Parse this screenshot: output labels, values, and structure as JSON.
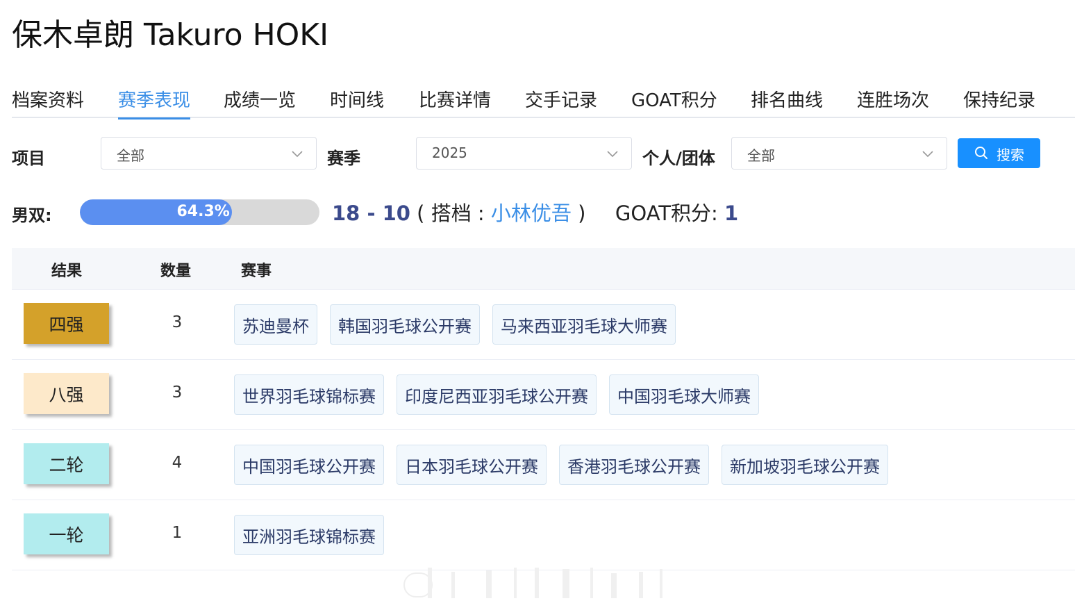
{
  "page": {
    "title": "保木卓朗 Takuro HOKI"
  },
  "tabs": [
    {
      "label": "档案资料"
    },
    {
      "label": "赛季表现",
      "active": true
    },
    {
      "label": "成绩一览"
    },
    {
      "label": "时间线"
    },
    {
      "label": "比赛详情"
    },
    {
      "label": "交手记录"
    },
    {
      "label": "GOAT积分"
    },
    {
      "label": "排名曲线"
    },
    {
      "label": "连胜场次"
    },
    {
      "label": "保持纪录"
    }
  ],
  "filters": {
    "event": {
      "label": "项目",
      "value": "全部"
    },
    "season": {
      "label": "赛季",
      "value": "2025"
    },
    "type": {
      "label": "个人/团体",
      "value": "全部"
    },
    "search_label": "搜索"
  },
  "summary": {
    "label": "男双:",
    "win_rate": 64.3,
    "win_rate_text": "64.3%",
    "record": "18 - 10",
    "partner_prefix": "( 搭档 :",
    "partner": "小林优吾",
    "partner_suffix": ")",
    "goat_label": "GOAT积分:",
    "goat_value": "1"
  },
  "table": {
    "headers": {
      "result": "结果",
      "count": "数量",
      "events": "赛事"
    },
    "rows": [
      {
        "result": "四强",
        "color": "#d4a12a",
        "count": "3",
        "events": [
          "苏迪曼杯",
          "韩国羽毛球公开赛",
          "马来西亚羽毛球大师赛"
        ]
      },
      {
        "result": "八强",
        "color": "#fde9ca",
        "count": "3",
        "events": [
          "世界羽毛球锦标赛",
          "印度尼西亚羽毛球公开赛",
          "中国羽毛球大师赛"
        ]
      },
      {
        "result": "二轮",
        "color": "#b2ecee",
        "count": "4",
        "events": [
          "中国羽毛球公开赛",
          "日本羽毛球公开赛",
          "香港羽毛球公开赛",
          "新加坡羽毛球公开赛"
        ]
      },
      {
        "result": "一轮",
        "color": "#b2ecee",
        "count": "1",
        "events": [
          "亚洲羽毛球锦标赛"
        ]
      }
    ]
  },
  "colors": {
    "accent": "#3a8ee6",
    "button": "#1890ff",
    "progress_fill": "#5b8ff0",
    "record": "#3b4a8c"
  }
}
